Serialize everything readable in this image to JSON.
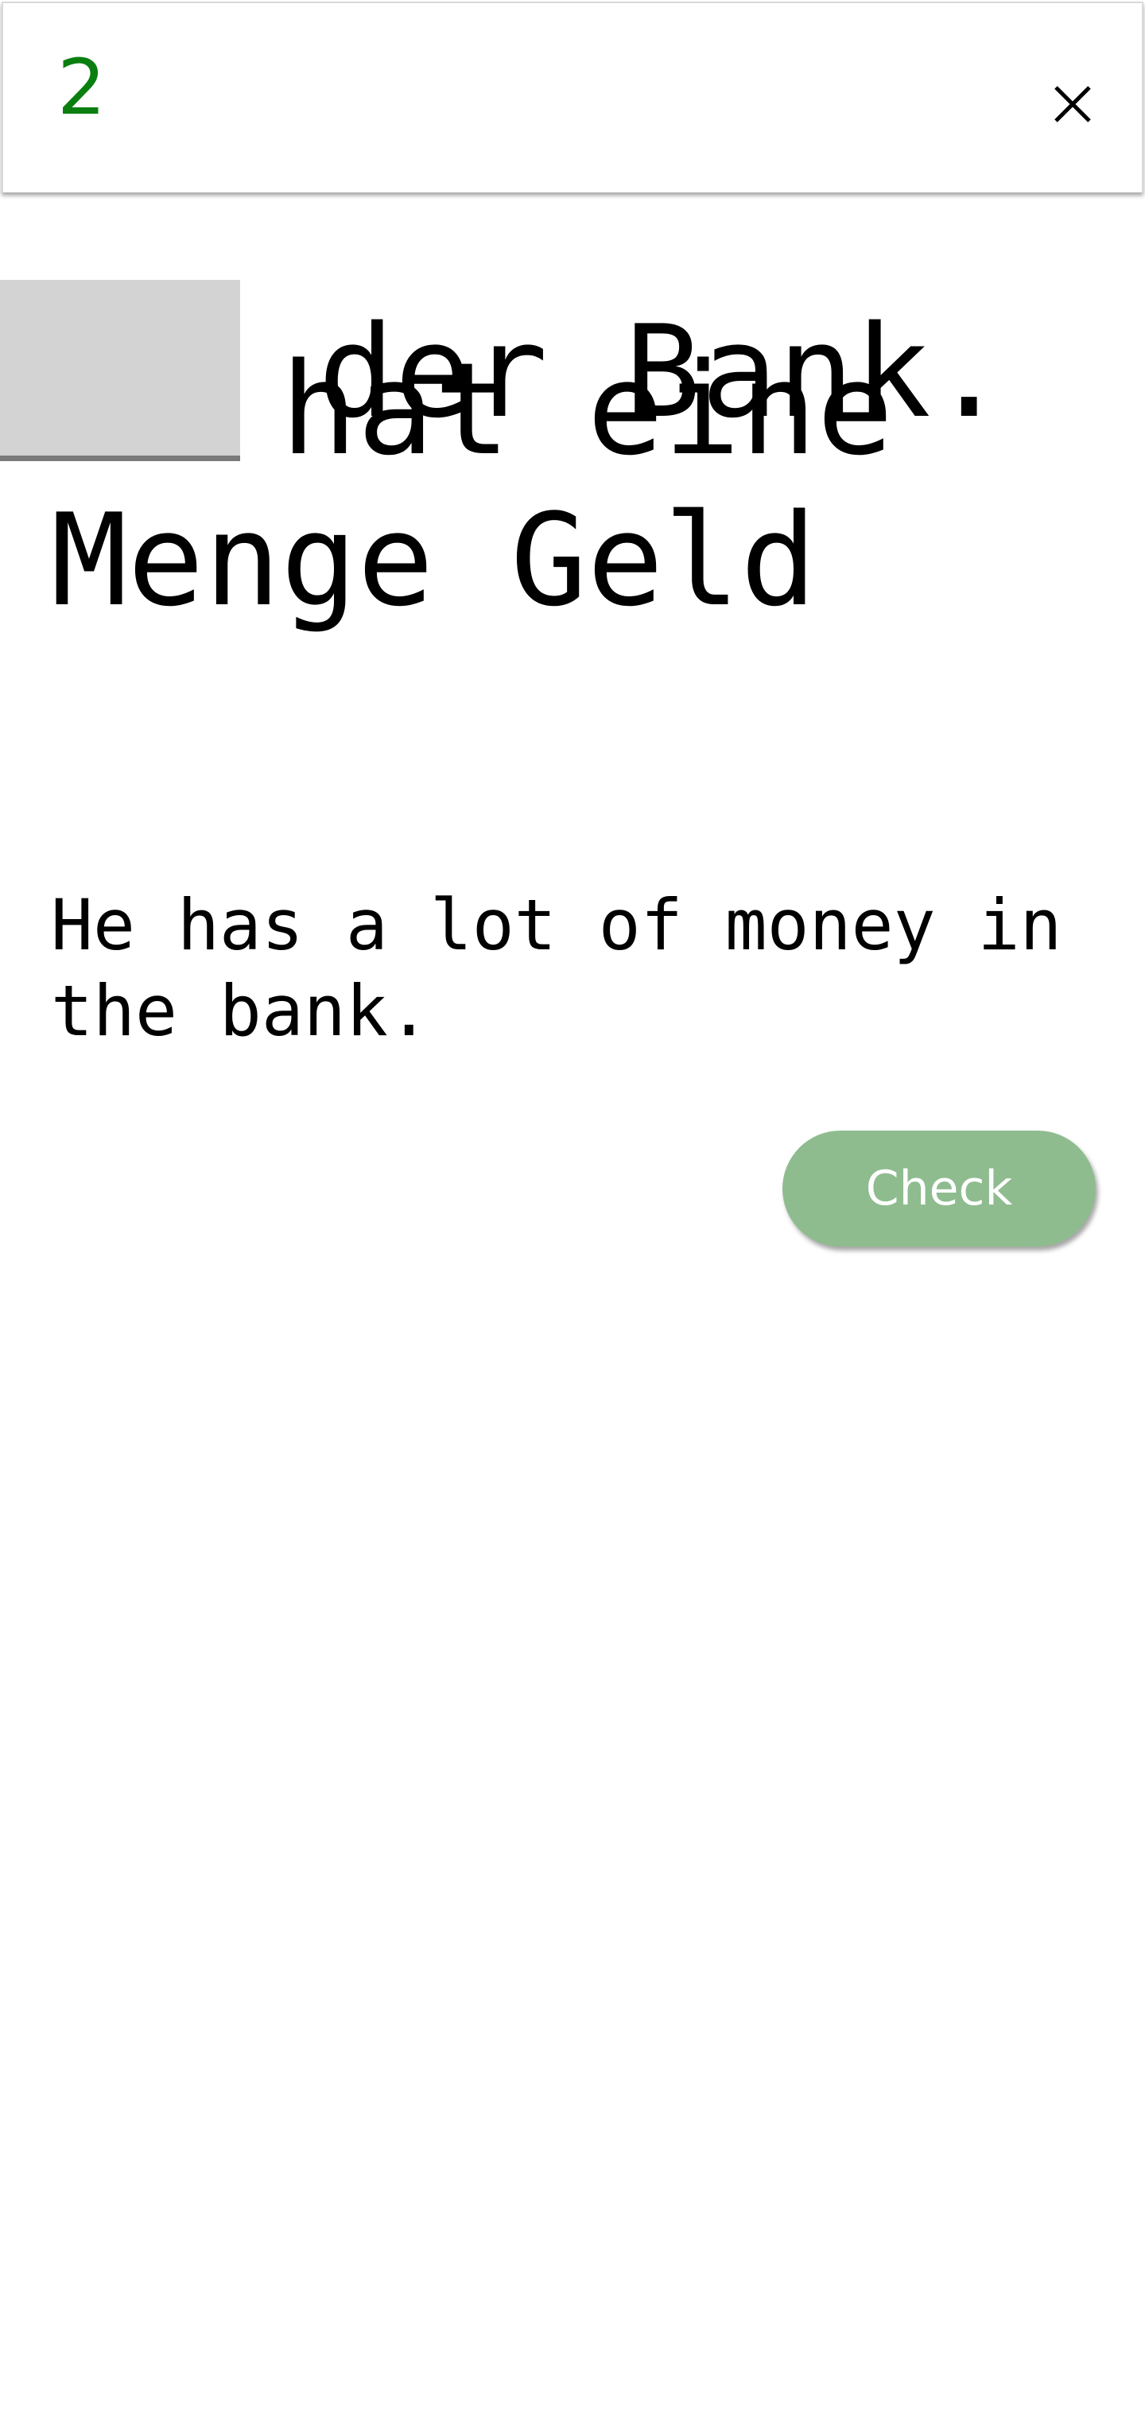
{
  "header": {
    "counter": "2",
    "close_icon": "close-icon"
  },
  "exercise": {
    "sentence_line1": "Er hat eine",
    "sentence_line2": "Menge Geld",
    "blank_value": "",
    "sentence_after_blank": "der Bank.",
    "translation": "He has a lot of money in the bank."
  },
  "actions": {
    "check_label": "Check"
  },
  "colors": {
    "counter": "#0a7f10",
    "blank_fill": "#d3d3d3",
    "blank_underline": "#7a7a7a",
    "check_button": "#8fbc8f",
    "check_text": "#ffffff"
  }
}
